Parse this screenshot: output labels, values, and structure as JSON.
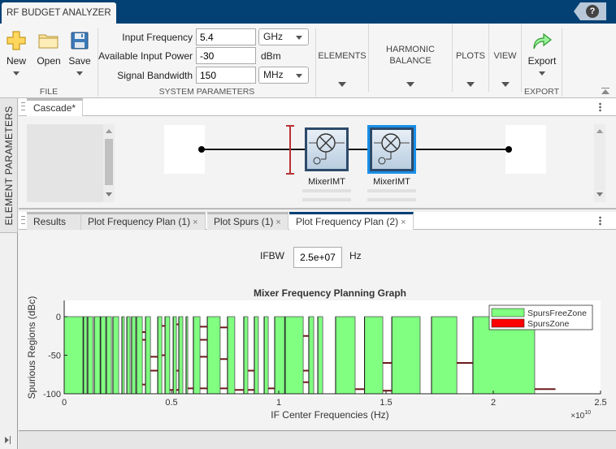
{
  "app": {
    "title": "RF BUDGET ANALYZER",
    "help_label": "?"
  },
  "ribbon": {
    "file": {
      "section_label": "FILE",
      "buttons": [
        {
          "label": "New",
          "icon": "plus-icon",
          "has_dropdown": true
        },
        {
          "label": "Open",
          "icon": "folder-icon",
          "has_dropdown": false
        },
        {
          "label": "Save",
          "icon": "floppy-disk-icon",
          "has_dropdown": true
        }
      ]
    },
    "system_parameters": {
      "section_label": "SYSTEM PARAMETERS",
      "input_frequency": {
        "label": "Input Frequency",
        "value": "5.4",
        "unit": "GHz"
      },
      "available_input_power": {
        "label": "Available Input Power",
        "value": "-30",
        "unit": "dBm"
      },
      "signal_bandwidth": {
        "label": "Signal Bandwidth",
        "value": "150",
        "unit": "MHz"
      }
    },
    "elements": {
      "label": "ELEMENTS"
    },
    "harmonic_balance": {
      "label_line1": "HARMONIC",
      "label_line2": "BALANCE"
    },
    "plots": {
      "label": "PLOTS"
    },
    "view": {
      "label": "VIEW"
    },
    "export": {
      "section_label": "EXPORT",
      "button_label": "Export",
      "icon": "export-arrow-icon"
    }
  },
  "side_panel": {
    "label": "ELEMENT PARAMETERS"
  },
  "canvas": {
    "tab_label": "Cascade*",
    "elements": [
      {
        "label": "MixerIMT",
        "selected": false
      },
      {
        "label": "MixerIMT",
        "selected": true
      }
    ]
  },
  "plot_tabs": [
    {
      "label": "Results",
      "closable": false,
      "active": false
    },
    {
      "label": "Plot Frequency Plan (1)",
      "closable": true,
      "active": false
    },
    {
      "label": "Plot Spurs (1)",
      "closable": true,
      "active": false
    },
    {
      "label": "Plot Frequency Plan (2)",
      "closable": true,
      "active": true
    }
  ],
  "plot_controls": {
    "ifbw_label": "IFBW",
    "ifbw_value": "2.5e+07",
    "ifbw_unit": "Hz",
    "close_glyph": "×"
  },
  "chart_data": {
    "type": "bar",
    "title": "Mixer Frequency Planning Graph",
    "xlabel": "IF Center Frequencies (Hz)",
    "ylabel": "Spurious Regions (dBc)",
    "x_exponent_label": "×10",
    "x_exponent_power": "10",
    "x_scale": 10000000000.0,
    "xlim": [
      0,
      2.5
    ],
    "ylim": [
      -100,
      0
    ],
    "xticks": [
      0,
      0.5,
      1,
      1.5,
      2,
      2.5
    ],
    "xtick_labels": [
      "0",
      "0.5",
      "1",
      "1.5",
      "2",
      "2.5"
    ],
    "yticks": [
      0,
      -50,
      -100
    ],
    "ytick_labels": [
      "0",
      "-50",
      "-100"
    ],
    "legend": {
      "position": "top-right",
      "entries": [
        {
          "name": "SpursFreeZone",
          "color": "#80ff80"
        },
        {
          "name": "SpursZone",
          "color": "#ff0000"
        }
      ]
    },
    "colors": {
      "free": "#80ff80",
      "free_edge": "#555555",
      "spur": "#6b1a1a"
    },
    "spurs_free_zones": [
      [
        0.0,
        0.087
      ],
      [
        0.09,
        0.106
      ],
      [
        0.11,
        0.133
      ],
      [
        0.14,
        0.167
      ],
      [
        0.17,
        0.193
      ],
      [
        0.197,
        0.22
      ],
      [
        0.227,
        0.254
      ],
      [
        0.269,
        0.28
      ],
      [
        0.292,
        0.307
      ],
      [
        0.314,
        0.333
      ],
      [
        0.337,
        0.364
      ],
      [
        0.379,
        0.402
      ],
      [
        0.436,
        0.455
      ],
      [
        0.47,
        0.492
      ],
      [
        0.508,
        0.523
      ],
      [
        0.534,
        0.553
      ],
      [
        0.568,
        0.576
      ],
      [
        0.602,
        0.633
      ],
      [
        0.667,
        0.727
      ],
      [
        0.761,
        0.795
      ],
      [
        0.837,
        0.856
      ],
      [
        0.886,
        0.905
      ],
      [
        0.932,
        0.951
      ],
      [
        0.981,
        1.027
      ],
      [
        1.03,
        1.114
      ],
      [
        1.14,
        1.163
      ],
      [
        1.182,
        1.205
      ],
      [
        1.265,
        1.356
      ],
      [
        1.4,
        1.485
      ],
      [
        1.527,
        1.659
      ],
      [
        1.712,
        1.83
      ],
      [
        1.905,
        2.193
      ]
    ],
    "spurs_zones": [
      {
        "x": [
          0.364,
          0.379
        ],
        "y": -20
      },
      {
        "x": [
          0.364,
          0.379
        ],
        "y": -30
      },
      {
        "x": [
          0.364,
          0.379
        ],
        "y": -88
      },
      {
        "x": [
          0.402,
          0.436
        ],
        "y": -52
      },
      {
        "x": [
          0.402,
          0.436
        ],
        "y": -70
      },
      {
        "x": [
          0.455,
          0.47
        ],
        "y": -12
      },
      {
        "x": [
          0.455,
          0.47
        ],
        "y": -50
      },
      {
        "x": [
          0.492,
          0.508
        ],
        "y": -95
      },
      {
        "x": [
          0.523,
          0.534
        ],
        "y": -10
      },
      {
        "x": [
          0.523,
          0.534
        ],
        "y": -70
      },
      {
        "x": [
          0.523,
          0.534
        ],
        "y": -95
      },
      {
        "x": [
          0.576,
          0.602
        ],
        "y": -93
      },
      {
        "x": [
          0.633,
          0.667
        ],
        "y": -13
      },
      {
        "x": [
          0.633,
          0.667
        ],
        "y": -30
      },
      {
        "x": [
          0.633,
          0.667
        ],
        "y": -52
      },
      {
        "x": [
          0.633,
          0.667
        ],
        "y": -93
      },
      {
        "x": [
          0.727,
          0.761
        ],
        "y": -14
      },
      {
        "x": [
          0.727,
          0.761
        ],
        "y": -55
      },
      {
        "x": [
          0.727,
          0.761
        ],
        "y": -93
      },
      {
        "x": [
          0.795,
          0.837
        ],
        "y": -95
      },
      {
        "x": [
          0.856,
          0.886
        ],
        "y": -70
      },
      {
        "x": [
          0.856,
          0.886
        ],
        "y": -95
      },
      {
        "x": [
          0.951,
          0.981
        ],
        "y": -93
      },
      {
        "x": [
          1.114,
          1.14
        ],
        "y": -25
      },
      {
        "x": [
          1.114,
          1.14
        ],
        "y": -70
      },
      {
        "x": [
          1.114,
          1.14
        ],
        "y": -85
      },
      {
        "x": [
          1.356,
          1.4
        ],
        "y": -94
      },
      {
        "x": [
          1.485,
          1.527
        ],
        "y": -60
      },
      {
        "x": [
          1.485,
          1.527
        ],
        "y": -96
      },
      {
        "x": [
          1.83,
          1.905
        ],
        "y": -60
      },
      {
        "x": [
          2.193,
          2.29
        ],
        "y": -94
      }
    ]
  }
}
